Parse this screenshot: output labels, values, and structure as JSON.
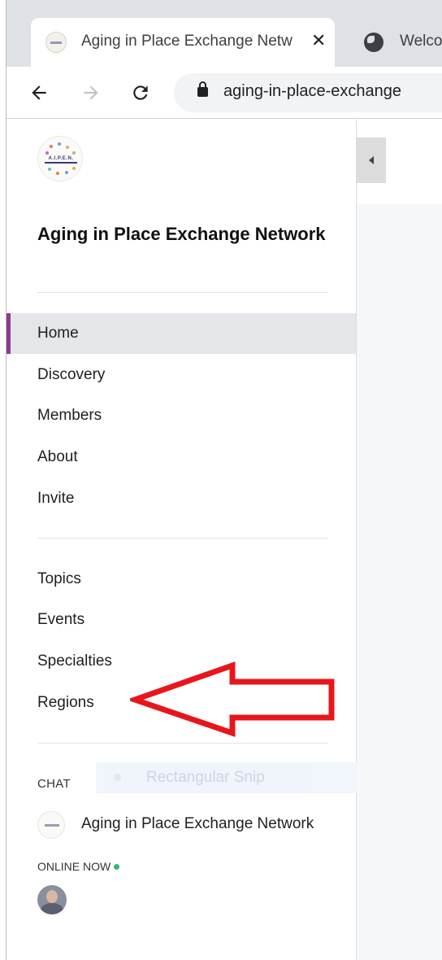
{
  "browser": {
    "active_tab_title": "Aging in Place Exchange Network",
    "inactive_tab_title": "Welcome",
    "url": "aging-in-place-exchange",
    "icons": {
      "back": "arrow-left-icon",
      "forward": "arrow-right-icon",
      "reload": "reload-icon",
      "lock": "lock-icon",
      "close": "close-icon",
      "globe": "globe-icon"
    }
  },
  "sidebar": {
    "logo_text": "A.I.P.E.N.",
    "site_title": "Aging in Place Exchange Network",
    "primary_nav": [
      {
        "label": "Home",
        "active": true
      },
      {
        "label": "Discovery",
        "active": false
      },
      {
        "label": "Members",
        "active": false
      },
      {
        "label": "About",
        "active": false
      },
      {
        "label": "Invite",
        "active": false
      }
    ],
    "secondary_nav": [
      {
        "label": "Topics"
      },
      {
        "label": "Events"
      },
      {
        "label": "Specialties"
      },
      {
        "label": "Regions"
      }
    ],
    "chat_heading": "CHAT",
    "chat_items": [
      {
        "name": "Aging in Place Exchange Network"
      }
    ],
    "online_heading": "ONLINE NOW",
    "accent_color": "#8e3a8e",
    "online_color": "#2bbf6a"
  },
  "overlay": {
    "snip_label": "Rectangular Snip"
  },
  "annotation": {
    "arrow_color": "#e8161b",
    "points_to": "Regions"
  }
}
